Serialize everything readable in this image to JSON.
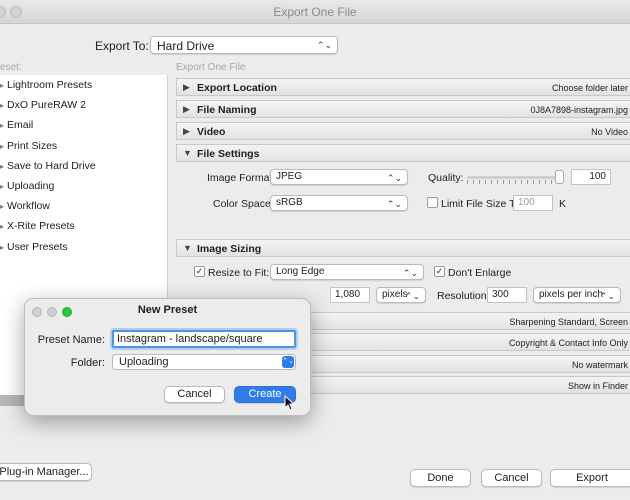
{
  "window": {
    "title": "Export One File"
  },
  "export_to": {
    "label": "Export To:",
    "value": "Hard Drive"
  },
  "preset_header": "eset:",
  "destination_header": "Export One File",
  "presets": [
    "Lightroom Presets",
    "DxO PureRAW 2",
    "Email",
    "Print Sizes",
    "Save to Hard Drive",
    "Uploading",
    "Workflow",
    "X-Rite Presets",
    "User Presets"
  ],
  "sections": {
    "export_location": {
      "name": "Export Location",
      "summary": "Choose folder later"
    },
    "file_naming": {
      "name": "File Naming",
      "summary": "0J8A7898-instagram.jpg"
    },
    "video": {
      "name": "Video",
      "summary": "No Video"
    },
    "file_settings": {
      "name": "File Settings"
    },
    "image_sizing": {
      "name": "Image Sizing"
    },
    "output_sharpening": {
      "summary": "Sharpening Standard, Screen"
    },
    "metadata": {
      "summary": "Copyright & Contact Info Only"
    },
    "watermarking": {
      "summary": "No watermark"
    },
    "post_processing": {
      "summary": "Show in Finder"
    }
  },
  "file_settings": {
    "image_format_label": "Image Format:",
    "image_format": "JPEG",
    "quality_label": "Quality:",
    "quality": "100",
    "color_space_label": "Color Space:",
    "color_space": "sRGB",
    "limit_label": "Limit File Size To:",
    "limit_value": "100",
    "limit_unit": "K"
  },
  "image_sizing": {
    "resize_label": "Resize to Fit:",
    "resize_mode": "Long Edge",
    "dont_enlarge_label": "Don't Enlarge",
    "size_value": "1,080",
    "size_unit": "pixels",
    "resolution_label": "Resolution:",
    "resolution_value": "300",
    "resolution_unit": "pixels per inch"
  },
  "footer": {
    "plugin_manager": "Plug-in Manager...",
    "done": "Done",
    "cancel": "Cancel",
    "export": "Export"
  },
  "dialog": {
    "title": "New Preset",
    "preset_name_label": "Preset Name:",
    "preset_name_value": "Instagram - landscape/square",
    "folder_label": "Folder:",
    "folder_value": "Uploading",
    "cancel": "Cancel",
    "create": "Create"
  },
  "icons": {
    "collapsed": "disclosure-right-icon",
    "expanded": "disclosure-down-icon",
    "check": "checkmark-icon"
  }
}
